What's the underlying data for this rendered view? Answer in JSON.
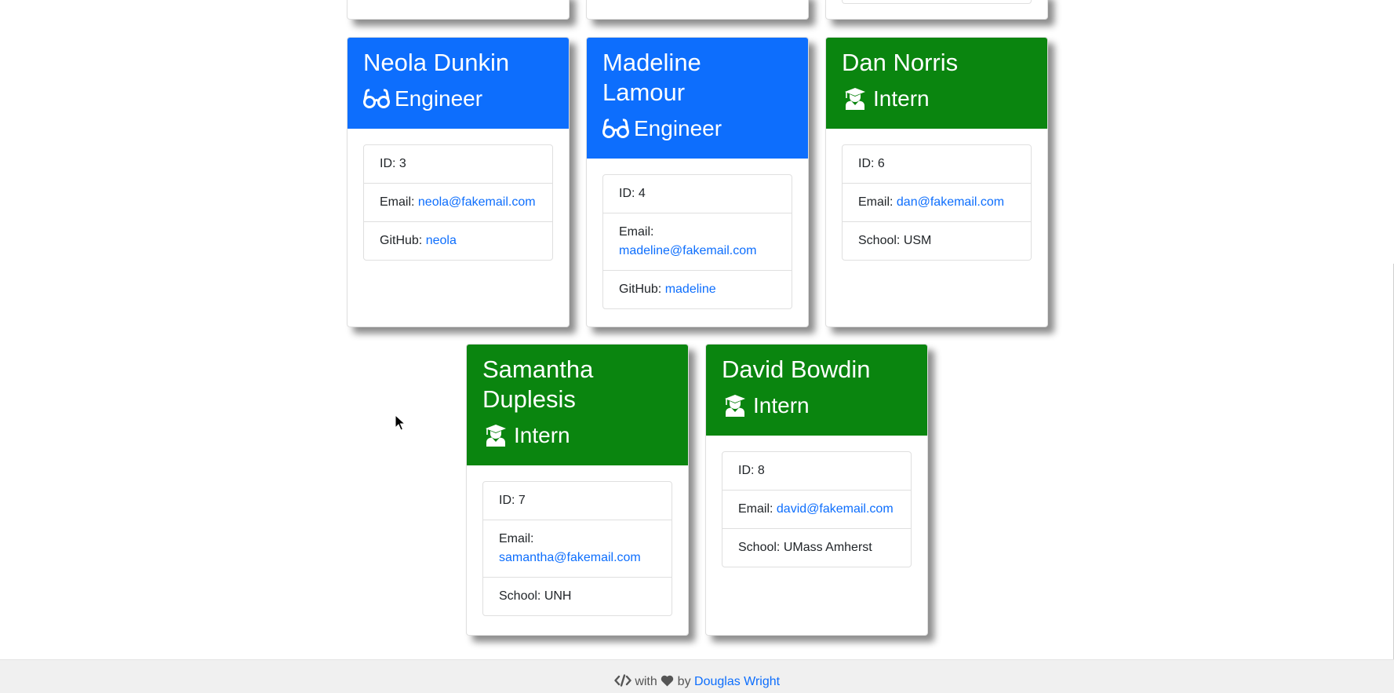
{
  "colors": {
    "engineer_header": "#0d6efd",
    "intern_header": "#0a850f",
    "link": "#0d6efd"
  },
  "cards": [
    {
      "name": "Neola Dunkin",
      "role": "Engineer",
      "role_icon": "glasses-icon",
      "id_label": "ID: 3",
      "email_label": "Email: ",
      "email": "neola@fakemail.com",
      "extra_label": "GitHub: ",
      "extra_value": "neola"
    },
    {
      "name": "Madeline Lamour",
      "role": "Engineer",
      "role_icon": "glasses-icon",
      "id_label": "ID: 4",
      "email_label": "Email: ",
      "email": "madeline@fakemail.com",
      "extra_label": "GitHub: ",
      "extra_value": "madeline"
    },
    {
      "name": "Dan Norris",
      "role": "Intern",
      "role_icon": "graduate-icon",
      "id_label": "ID: 6",
      "email_label": "Email: ",
      "email": "dan@fakemail.com",
      "extra_label": "School: ",
      "extra_value": "USM"
    },
    {
      "name": "Samantha Duplesis",
      "role": "Intern",
      "role_icon": "graduate-icon",
      "id_label": "ID: 7",
      "email_label": "Email: ",
      "email": "samantha@fakemail.com",
      "extra_label": "School: ",
      "extra_value": "UNH"
    },
    {
      "name": "David Bowdin",
      "role": "Intern",
      "role_icon": "graduate-icon",
      "id_label": "ID: 8",
      "email_label": "Email: ",
      "email": "david@fakemail.com",
      "extra_label": "School: ",
      "extra_value": "UMass Amherst"
    }
  ],
  "footer": {
    "code_icon": "code-icon",
    "with_text": " with ",
    "heart_icon": "heart-icon",
    "by_text": " by ",
    "author": "Douglas Wright"
  }
}
